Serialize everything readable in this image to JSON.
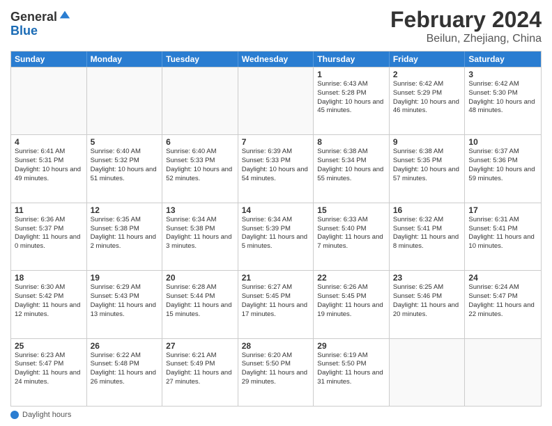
{
  "logo": {
    "general": "General",
    "blue": "Blue"
  },
  "header": {
    "month": "February 2024",
    "location": "Beilun, Zhejiang, China"
  },
  "weekdays": [
    "Sunday",
    "Monday",
    "Tuesday",
    "Wednesday",
    "Thursday",
    "Friday",
    "Saturday"
  ],
  "footer": {
    "label": "Daylight hours"
  },
  "rows": [
    [
      {
        "day": "",
        "info": ""
      },
      {
        "day": "",
        "info": ""
      },
      {
        "day": "",
        "info": ""
      },
      {
        "day": "",
        "info": ""
      },
      {
        "day": "1",
        "info": "Sunrise: 6:43 AM\nSunset: 5:28 PM\nDaylight: 10 hours and 45 minutes."
      },
      {
        "day": "2",
        "info": "Sunrise: 6:42 AM\nSunset: 5:29 PM\nDaylight: 10 hours and 46 minutes."
      },
      {
        "day": "3",
        "info": "Sunrise: 6:42 AM\nSunset: 5:30 PM\nDaylight: 10 hours and 48 minutes."
      }
    ],
    [
      {
        "day": "4",
        "info": "Sunrise: 6:41 AM\nSunset: 5:31 PM\nDaylight: 10 hours and 49 minutes."
      },
      {
        "day": "5",
        "info": "Sunrise: 6:40 AM\nSunset: 5:32 PM\nDaylight: 10 hours and 51 minutes."
      },
      {
        "day": "6",
        "info": "Sunrise: 6:40 AM\nSunset: 5:33 PM\nDaylight: 10 hours and 52 minutes."
      },
      {
        "day": "7",
        "info": "Sunrise: 6:39 AM\nSunset: 5:33 PM\nDaylight: 10 hours and 54 minutes."
      },
      {
        "day": "8",
        "info": "Sunrise: 6:38 AM\nSunset: 5:34 PM\nDaylight: 10 hours and 55 minutes."
      },
      {
        "day": "9",
        "info": "Sunrise: 6:38 AM\nSunset: 5:35 PM\nDaylight: 10 hours and 57 minutes."
      },
      {
        "day": "10",
        "info": "Sunrise: 6:37 AM\nSunset: 5:36 PM\nDaylight: 10 hours and 59 minutes."
      }
    ],
    [
      {
        "day": "11",
        "info": "Sunrise: 6:36 AM\nSunset: 5:37 PM\nDaylight: 11 hours and 0 minutes."
      },
      {
        "day": "12",
        "info": "Sunrise: 6:35 AM\nSunset: 5:38 PM\nDaylight: 11 hours and 2 minutes."
      },
      {
        "day": "13",
        "info": "Sunrise: 6:34 AM\nSunset: 5:38 PM\nDaylight: 11 hours and 3 minutes."
      },
      {
        "day": "14",
        "info": "Sunrise: 6:34 AM\nSunset: 5:39 PM\nDaylight: 11 hours and 5 minutes."
      },
      {
        "day": "15",
        "info": "Sunrise: 6:33 AM\nSunset: 5:40 PM\nDaylight: 11 hours and 7 minutes."
      },
      {
        "day": "16",
        "info": "Sunrise: 6:32 AM\nSunset: 5:41 PM\nDaylight: 11 hours and 8 minutes."
      },
      {
        "day": "17",
        "info": "Sunrise: 6:31 AM\nSunset: 5:41 PM\nDaylight: 11 hours and 10 minutes."
      }
    ],
    [
      {
        "day": "18",
        "info": "Sunrise: 6:30 AM\nSunset: 5:42 PM\nDaylight: 11 hours and 12 minutes."
      },
      {
        "day": "19",
        "info": "Sunrise: 6:29 AM\nSunset: 5:43 PM\nDaylight: 11 hours and 13 minutes."
      },
      {
        "day": "20",
        "info": "Sunrise: 6:28 AM\nSunset: 5:44 PM\nDaylight: 11 hours and 15 minutes."
      },
      {
        "day": "21",
        "info": "Sunrise: 6:27 AM\nSunset: 5:45 PM\nDaylight: 11 hours and 17 minutes."
      },
      {
        "day": "22",
        "info": "Sunrise: 6:26 AM\nSunset: 5:45 PM\nDaylight: 11 hours and 19 minutes."
      },
      {
        "day": "23",
        "info": "Sunrise: 6:25 AM\nSunset: 5:46 PM\nDaylight: 11 hours and 20 minutes."
      },
      {
        "day": "24",
        "info": "Sunrise: 6:24 AM\nSunset: 5:47 PM\nDaylight: 11 hours and 22 minutes."
      }
    ],
    [
      {
        "day": "25",
        "info": "Sunrise: 6:23 AM\nSunset: 5:47 PM\nDaylight: 11 hours and 24 minutes."
      },
      {
        "day": "26",
        "info": "Sunrise: 6:22 AM\nSunset: 5:48 PM\nDaylight: 11 hours and 26 minutes."
      },
      {
        "day": "27",
        "info": "Sunrise: 6:21 AM\nSunset: 5:49 PM\nDaylight: 11 hours and 27 minutes."
      },
      {
        "day": "28",
        "info": "Sunrise: 6:20 AM\nSunset: 5:50 PM\nDaylight: 11 hours and 29 minutes."
      },
      {
        "day": "29",
        "info": "Sunrise: 6:19 AM\nSunset: 5:50 PM\nDaylight: 11 hours and 31 minutes."
      },
      {
        "day": "",
        "info": ""
      },
      {
        "day": "",
        "info": ""
      }
    ]
  ]
}
